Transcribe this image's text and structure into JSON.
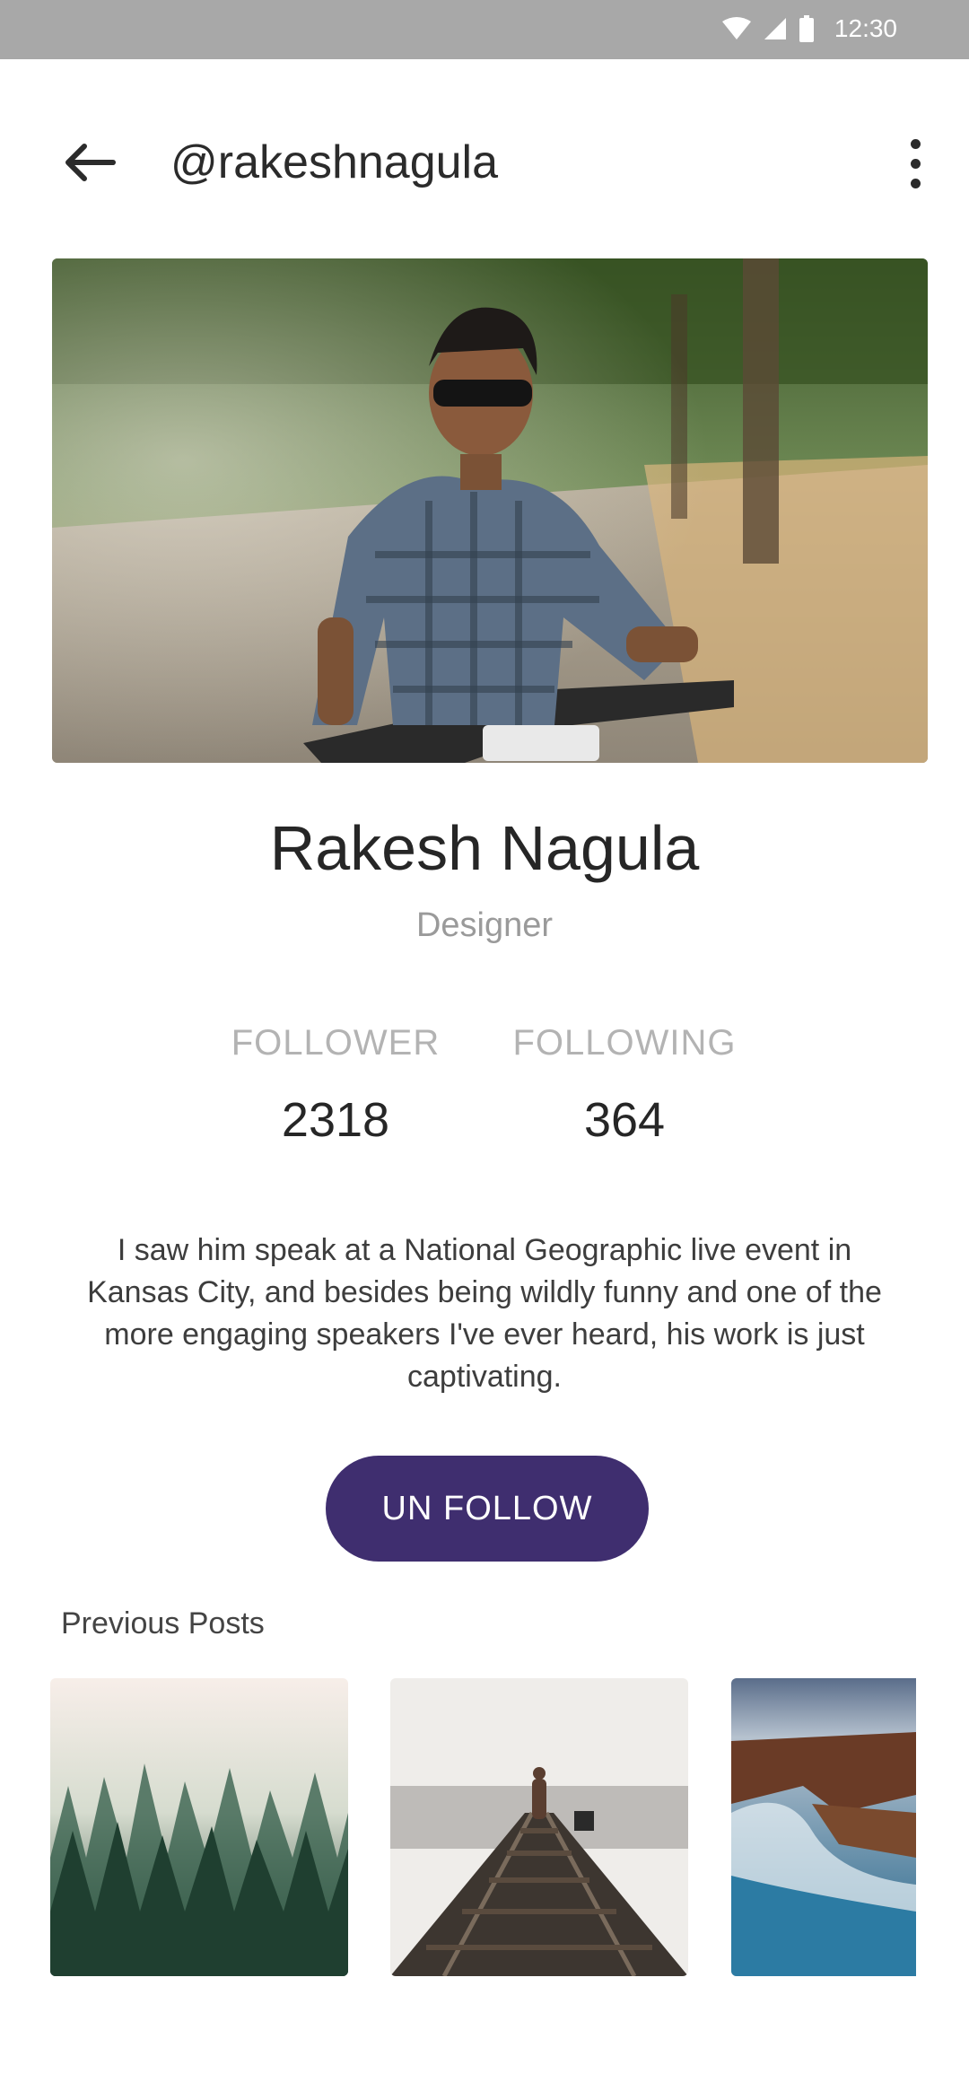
{
  "status_bar": {
    "time": "12:30",
    "icons": [
      "wifi-icon",
      "cell-signal-icon",
      "battery-icon"
    ]
  },
  "header": {
    "handle": "@rakeshnagula",
    "back_icon": "arrow-left-icon",
    "menu_icon": "more-vertical-icon"
  },
  "profile": {
    "name": "Rakesh Nagula",
    "role": "Designer",
    "bio": "I saw him speak at a National Geographic live event in Kansas City, and besides being wildly funny and one of the more engaging speakers I've ever heard, his work is just captivating."
  },
  "stats": {
    "follower_label": "FOLLOWER",
    "follower_value": "2318",
    "following_label": "FOLLOWING",
    "following_value": "364"
  },
  "actions": {
    "unfollow_label": "UN FOLLOW"
  },
  "posts": {
    "title": "Previous Posts"
  },
  "colors": {
    "accent": "#3f2e6f",
    "status_bar": "#a8a8a8"
  }
}
